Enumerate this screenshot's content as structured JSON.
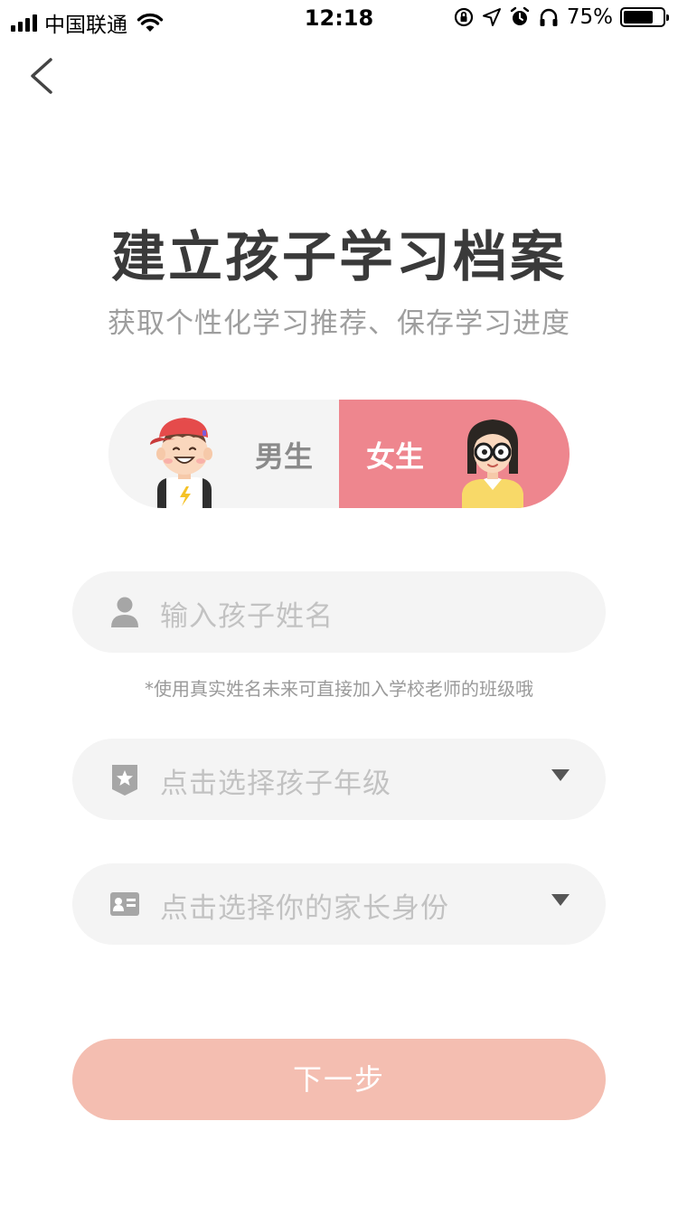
{
  "status_bar": {
    "carrier": "中国联通",
    "time": "12:18",
    "battery_percent": "75%",
    "battery_level": 0.75
  },
  "page": {
    "title": "建立孩子学习档案",
    "subtitle": "获取个性化学习推荐、保存学习进度"
  },
  "gender": {
    "male_label": "男生",
    "female_label": "女生",
    "selected": "female",
    "selected_color": "#ee868e"
  },
  "form": {
    "name_placeholder": "输入孩子姓名",
    "name_hint": "*使用真实姓名未来可直接加入学校老师的班级哦",
    "grade_placeholder": "点击选择孩子年级",
    "parent_placeholder": "点击选择你的家长身份"
  },
  "next_button": {
    "label": "下一步",
    "color": "#f4beb1"
  },
  "icons": [
    "back-arrow-icon",
    "user-icon",
    "grade-badge-icon",
    "id-card-icon",
    "caret-down-icon",
    "wifi-icon",
    "orientation-lock-icon",
    "location-arrow-icon",
    "alarm-icon",
    "headphones-icon",
    "battery-icon"
  ]
}
